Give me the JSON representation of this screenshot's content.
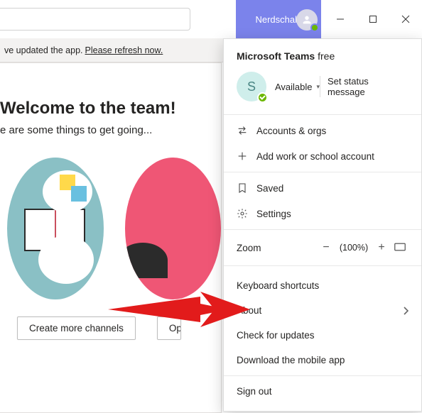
{
  "titlebar": {
    "tenant": "Nerdschalk"
  },
  "banner": {
    "pre": "ve updated the app.",
    "link": "Please refresh now."
  },
  "main": {
    "heading": "Welcome to the team!",
    "sub": "e are some things to get going...",
    "btn1": "Create more channels",
    "btn2": "Op"
  },
  "panel": {
    "title_bold": "Microsoft Teams",
    "title_rest": " free",
    "avatar_initial": "S",
    "status": "Available",
    "set_status": "Set status message",
    "accounts": "Accounts & orgs",
    "add_account": "Add work or school account",
    "saved": "Saved",
    "settings": "Settings",
    "zoom_label": "Zoom",
    "zoom_pct": "(100%)",
    "shortcuts": "Keyboard shortcuts",
    "about": "About",
    "check_updates": "Check for updates",
    "download": "Download the mobile app",
    "signout": "Sign out"
  }
}
